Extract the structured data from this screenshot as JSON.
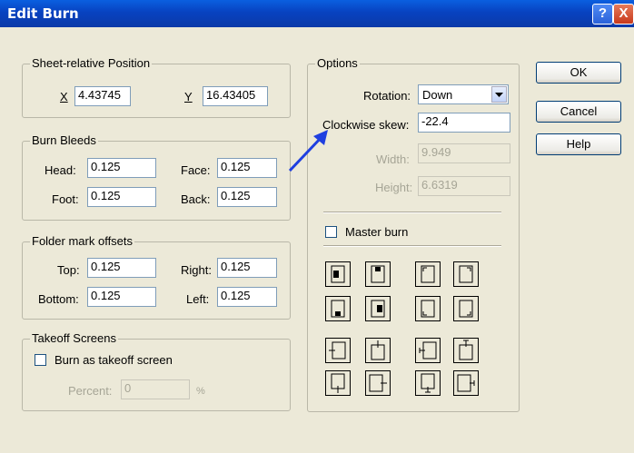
{
  "window": {
    "title": "Edit Burn",
    "help_glyph": "?",
    "close_glyph": "X"
  },
  "buttons": {
    "ok": "OK",
    "cancel": "Cancel",
    "help": "Help"
  },
  "sheet_position": {
    "legend": "Sheet-relative Position",
    "x_label": "X",
    "x_value": "4.43745",
    "y_label": "Y",
    "y_value": "16.43405"
  },
  "burn_bleeds": {
    "legend": "Burn Bleeds",
    "head_label": "Head:",
    "head_value": "0.125",
    "face_label": "Face:",
    "face_value": "0.125",
    "foot_label": "Foot:",
    "foot_value": "0.125",
    "back_label": "Back:",
    "back_value": "0.125"
  },
  "folder_mark_offsets": {
    "legend": "Folder mark offsets",
    "top_label": "Top:",
    "top_value": "0.125",
    "right_label": "Right:",
    "right_value": "0.125",
    "bottom_label": "Bottom:",
    "bottom_value": "0.125",
    "left_label": "Left:",
    "left_value": "0.125"
  },
  "takeoff_screens": {
    "legend": "Takeoff Screens",
    "checkbox_label": "Burn as takeoff screen",
    "percent_label": "Percent:",
    "percent_value": "0",
    "percent_unit": "%"
  },
  "options": {
    "legend": "Options",
    "rotation_label": "Rotation:",
    "rotation_value": "Down",
    "skew_label": "Clockwise skew:",
    "skew_value": "-22.4",
    "width_label": "Width:",
    "width_value": "9.949",
    "height_label": "Height:",
    "height_value": "6.6319",
    "master_burn_label": "Master burn"
  },
  "colors": {
    "titlebar": "#0842c0",
    "arrow": "#1f3fe0"
  },
  "icons": [
    "page-icon"
  ]
}
